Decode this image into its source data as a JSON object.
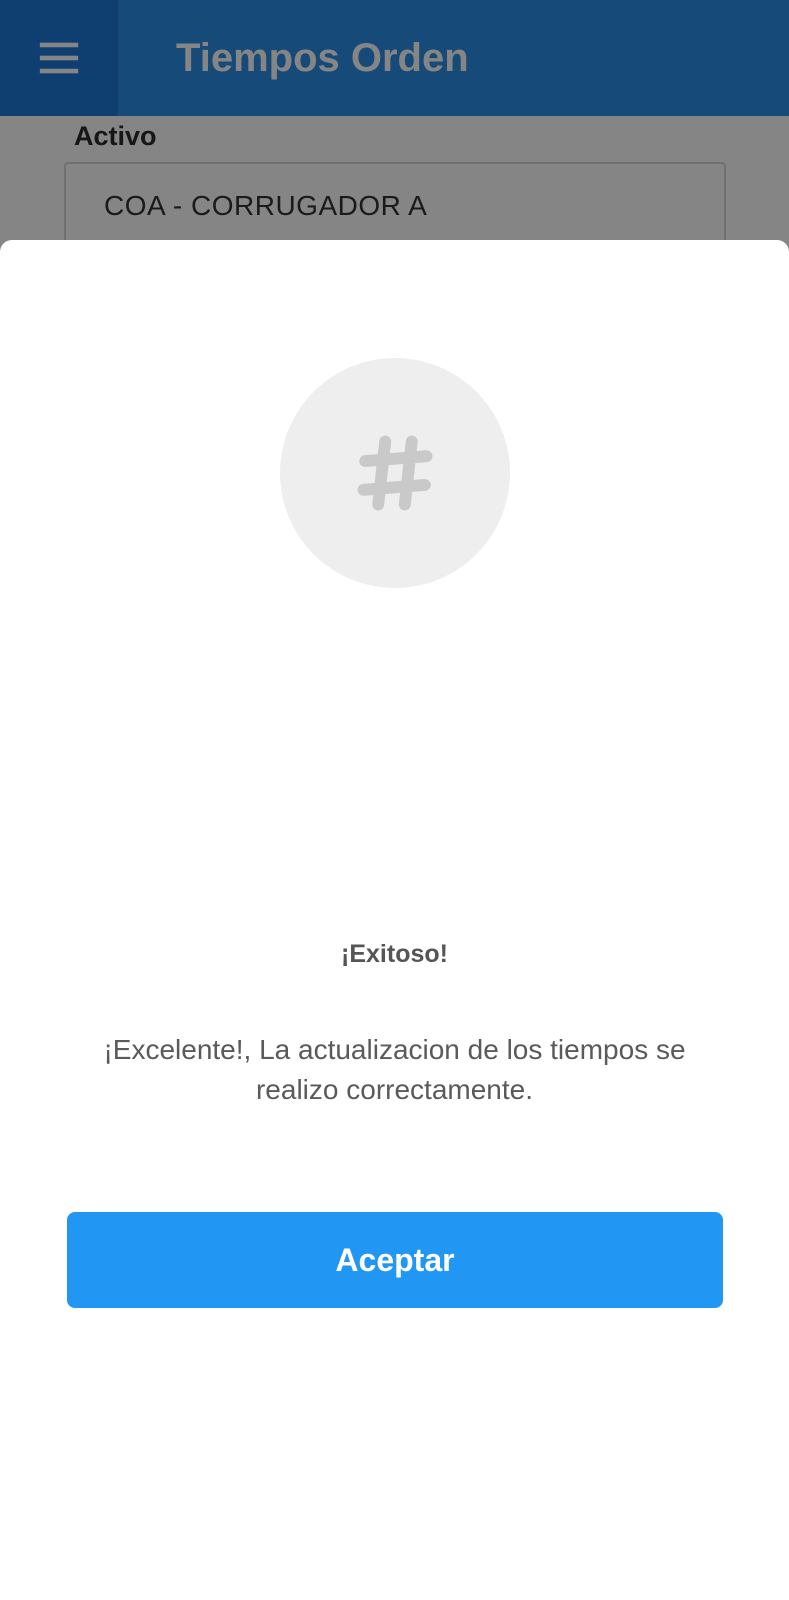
{
  "app_bar": {
    "title": "Tiempos Orden",
    "menu_icon": "menu-icon",
    "color": "#2a8ee8"
  },
  "form": {
    "activo_label": "Activo",
    "activo_value": "COA - CORRUGADOR A"
  },
  "dialog": {
    "icon": "hashtag-icon",
    "title": "¡Exitoso!",
    "message": "¡Excelente!, La actualizacion de los tiempos se realizo correctamente.",
    "accept_label": "Aceptar",
    "accent": "#2196f3"
  }
}
